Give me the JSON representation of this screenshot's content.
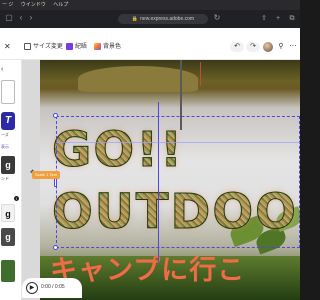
{
  "menubar": {
    "items": [
      "ー ジ",
      "ウインドウ",
      "ヘルプ"
    ]
  },
  "browser": {
    "url": "new.express.adobe.com"
  },
  "toolbar": {
    "resize_label": "サイズ変更",
    "animate_label": "紀晤",
    "background_label": "背景色"
  },
  "leftrail": {
    "label_fonts": "ーズ",
    "label_link": "表示",
    "label_blend": "ンド",
    "tile_text": "g"
  },
  "canvas": {
    "headline_line1": "GO!!",
    "headline_line2": "OUTDOO",
    "subtext": "キャンプに行こ",
    "selection_tag": "Scale 1 Text"
  },
  "timeline": {
    "time": "0:00 / 0:05"
  },
  "colors": {
    "accent": "#4f46e5",
    "subtext": "#f26b47",
    "tag": "#f2a03d"
  }
}
